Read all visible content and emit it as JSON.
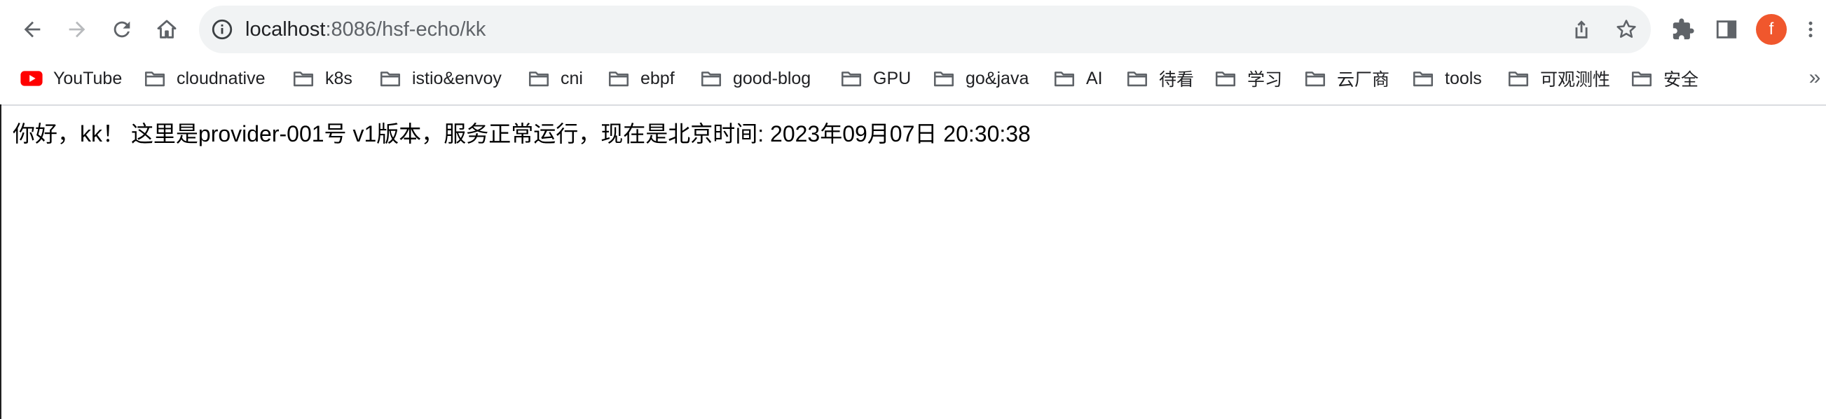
{
  "browser": {
    "url_host": "localhost",
    "url_rest": ":8086/hsf-echo/kk",
    "profile_initial": "f",
    "colors": {
      "omnibox_bg": "#f1f3f4",
      "avatar_bg": "#f0572d",
      "youtube_red": "#ff0000",
      "icon_gray": "#5f6368"
    }
  },
  "bookmarks": {
    "items": [
      {
        "label": "YouTube",
        "icon": "youtube-icon"
      },
      {
        "label": "cloudnative",
        "icon": "folder-icon"
      },
      {
        "label": "k8s",
        "icon": "folder-icon"
      },
      {
        "label": "istio&envoy",
        "icon": "folder-icon"
      },
      {
        "label": "cni",
        "icon": "folder-icon"
      },
      {
        "label": "ebpf",
        "icon": "folder-icon"
      },
      {
        "label": "good-blog",
        "icon": "folder-icon"
      },
      {
        "label": "GPU",
        "icon": "folder-icon"
      },
      {
        "label": "go&java",
        "icon": "folder-icon"
      },
      {
        "label": "AI",
        "icon": "folder-icon"
      },
      {
        "label": "待看",
        "icon": "folder-icon"
      },
      {
        "label": "学习",
        "icon": "folder-icon"
      },
      {
        "label": "云厂商",
        "icon": "folder-icon"
      },
      {
        "label": "tools",
        "icon": "folder-icon"
      },
      {
        "label": "可观测性",
        "icon": "folder-icon"
      },
      {
        "label": "安全",
        "icon": "folder-icon"
      }
    ],
    "more": "»"
  },
  "page": {
    "message": "你好，kk！ 这里是provider-001号 v1版本，服务正常运行，现在是北京时间: 2023年09月07日 20:30:38"
  }
}
